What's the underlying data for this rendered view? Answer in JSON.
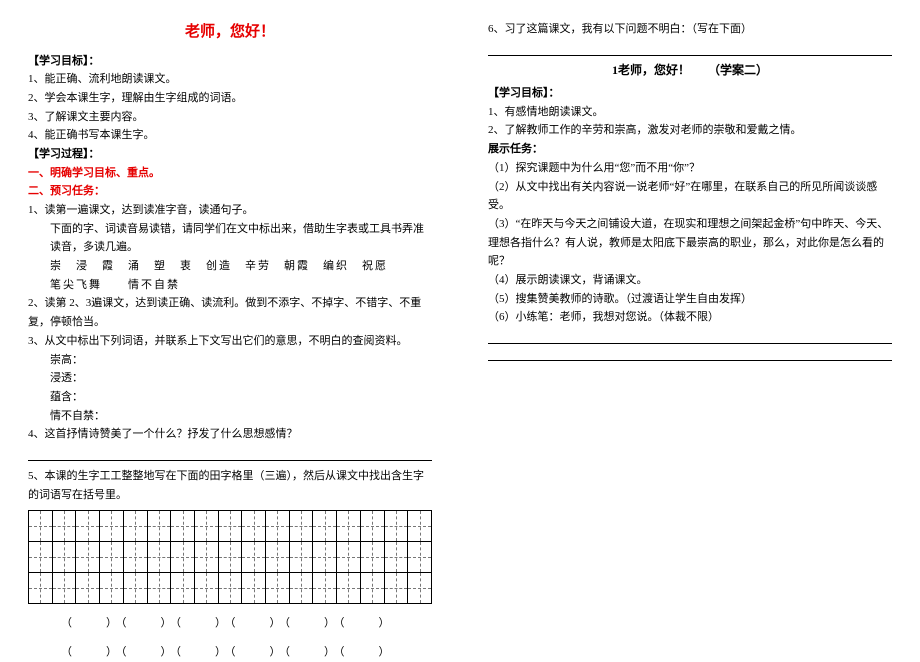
{
  "left": {
    "title": "老师，您好！",
    "goals_header": "【学习目标】：",
    "goal1": "1、能正确、流利地朗读课文。",
    "goal2": "2、学会本课生字，理解由生字组成的词语。",
    "goal3": "3、了解课文主要内容。",
    "goal4": "4、能正确书写本课生字。",
    "process_header": "【学习过程】：",
    "step1": "一、明确学习目标、重点。",
    "step2": "二、预习任务：",
    "t1": "1、读第一遍课文，达到读准字音，读通句子。",
    "t1a": "下面的字、词读音易读错，请同学们在文中标出来，借助生字表或工具书弄准读音，多读几遍。",
    "vocab1": "崇　浸　霞　涌　塑　衷　创造　辛劳　朝霞　编织　祝愿",
    "vocab2": "笔尖飞舞　　情不自禁",
    "t2": "2、读第 2、3遍课文，达到读正确、读流利。做到不添字、不掉字、不错字、不重复，停顿恰当。",
    "t3": "3、从文中标出下列词语，并联系上下文写出它们的意思，不明白的查阅资料。",
    "w1": "崇高：",
    "w2": "浸透：",
    "w3": "蕴含：",
    "w4": "情不自禁：",
    "t4": "4、这首抒情诗赞美了一个什么？抒发了什么思想感情？",
    "t5": "5、本课的生字工工整整地写在下面的田字格里（三遍），然后从课文中找出含生字的词语写在括号里。",
    "parens": "（　　）（　　）（　　）（　　）（　　）（　　）",
    "parens2": "（　　）（　　）（　　）（　　）（　　）（　　）"
  },
  "right": {
    "q6": "6、习了这篇课文，我有以下问题不明白：（写在下面）",
    "title2": "1老师，您好！　　（学案二）",
    "goals_header": "【学习目标】：",
    "g1": "1、有感情地朗读课文。",
    "g2": "2、了解教师工作的辛劳和崇高，激发对老师的崇敬和爱戴之情。",
    "show_header": "展示任务：",
    "s1": "（1）探究课题中为什么用“您”而不用“你”？",
    "s2": "（2）从文中找出有关内容说一说老师“好”在哪里，在联系自己的所见所闻谈谈感受。",
    "s3": "（3）“在昨天与今天之间铺设大道，在现实和理想之间架起金桥”句中昨天、今天、理想各指什么？有人说，教师是太阳底下最崇高的职业，那么，对此你是怎么看的呢？",
    "s4": "（4）展示朗读课文，背诵课文。",
    "s5": "（5）搜集赞美教师的诗歌。（过渡语让学生自由发挥）",
    "s6": "（6）小练笔：老师，我想对您说。（体裁不限）"
  }
}
